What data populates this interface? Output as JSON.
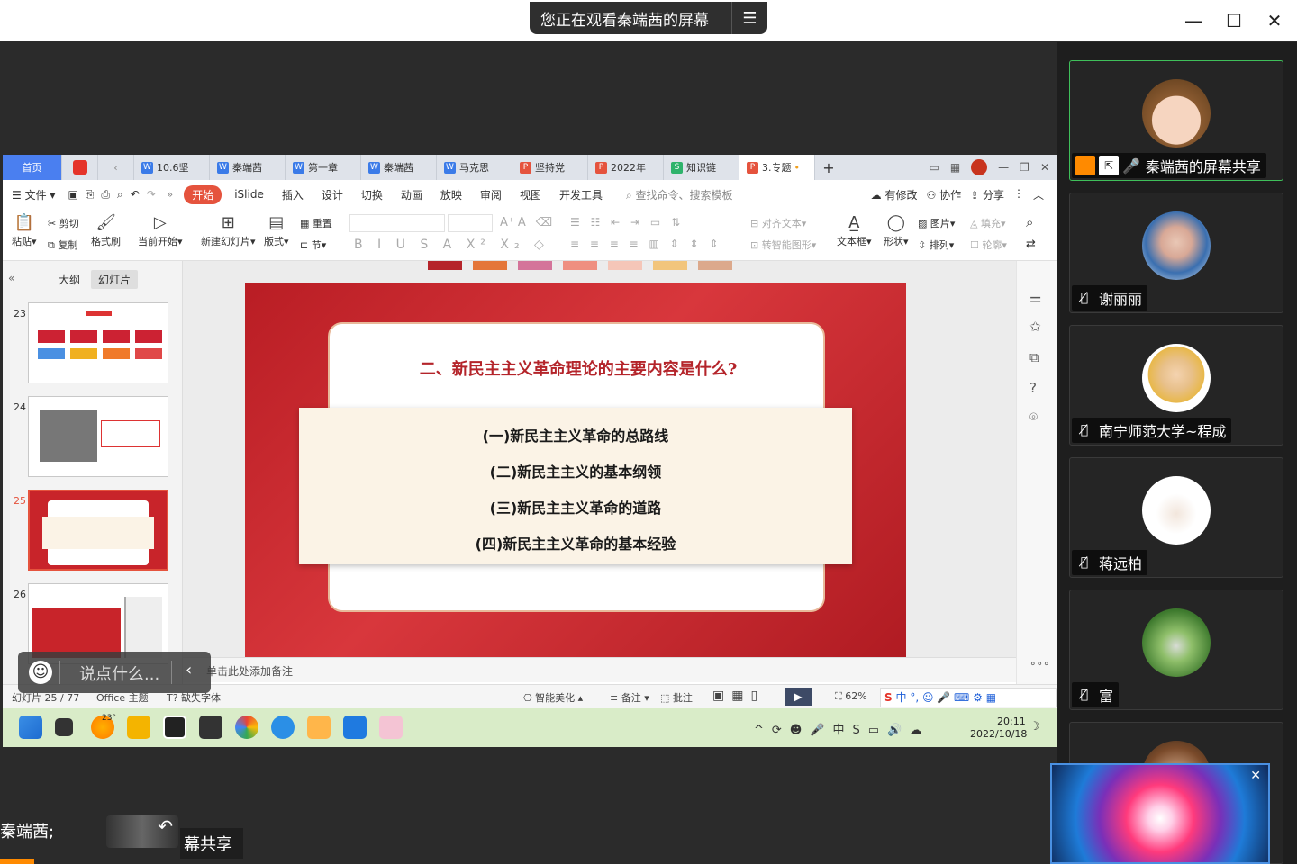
{
  "meeting": {
    "share_banner": "您正在观看秦端茜的屏幕",
    "bottom_name": "秦端茜;",
    "bottom_share_label": "幕共享",
    "chat_placeholder": "说点什么...",
    "participants": [
      {
        "name": "秦端茜的屏幕共享",
        "active": true
      },
      {
        "name": "谢丽丽",
        "active": false
      },
      {
        "name": "南宁师范大学~程成",
        "active": false
      },
      {
        "name": "蒋远柏",
        "active": false
      },
      {
        "name": "富",
        "active": false
      }
    ]
  },
  "wps": {
    "tabs": [
      {
        "label": "首页",
        "kind": "home"
      },
      {
        "label": "10.6坚",
        "color": "#3b7be8",
        "icon": "W"
      },
      {
        "label": "秦端茜",
        "color": "#3b7be8",
        "icon": "W"
      },
      {
        "label": "第一章",
        "color": "#3b7be8",
        "icon": "W"
      },
      {
        "label": "秦端茜",
        "color": "#3b7be8",
        "icon": "W"
      },
      {
        "label": "马克思",
        "color": "#3b7be8",
        "icon": "W"
      },
      {
        "label": "坚持党",
        "color": "#e5533d",
        "icon": "P"
      },
      {
        "label": "2022年",
        "color": "#e5533d",
        "icon": "P"
      },
      {
        "label": "知识链",
        "color": "#2fb36b",
        "icon": "S"
      },
      {
        "label": "3.专题",
        "color": "#e5533d",
        "icon": "P",
        "active": true
      }
    ],
    "menu": [
      "文件",
      "开始",
      "iSlide",
      "插入",
      "设计",
      "切换",
      "动画",
      "放映",
      "审阅",
      "视图",
      "开发工具"
    ],
    "menu_active": "开始",
    "search_placeholder": "查找命令、搜索模板",
    "right_actions": [
      "有修改",
      "协作",
      "分享"
    ],
    "ribbon": {
      "paste": "粘贴",
      "cut": "剪切",
      "copy": "复制",
      "format_painter": "格式刷",
      "from_current": "当前开始",
      "new_slide": "新建幻灯片",
      "layout": "版式",
      "reset": "重置",
      "section": "节",
      "align_text": "对齐文本",
      "smart_shape": "转智能图形",
      "textbox": "文本框",
      "shape": "形状",
      "picture": "图片",
      "fill": "填充",
      "arrange": "排列",
      "outline": "轮廓"
    },
    "left_panel": {
      "tab_outline": "大纲",
      "tab_slides": "幻灯片",
      "slides": [
        {
          "num": "23"
        },
        {
          "num": "24"
        },
        {
          "num": "25",
          "selected": true
        },
        {
          "num": "26"
        }
      ]
    },
    "slide": {
      "title": "二、新民主主义革命理论的主要内容是什么?",
      "items": [
        "(一)新民主主义革命的总路线",
        "(二)新民主主义的基本纲领",
        "(三)新民主主义革命的道路",
        "(四)新民主主义革命的基本经验"
      ]
    },
    "notes_placeholder": "单击此处添加备注",
    "status": {
      "slide_counter": "幻灯片 25 / 77",
      "theme": "Office 主题",
      "missing_font": "缺失字体",
      "beautify": "智能美化",
      "notes": "备注",
      "comments": "批注",
      "zoom": "62%"
    }
  },
  "taskbar": {
    "weather": "23°",
    "time": "20:11",
    "date": "2022/10/18",
    "ime": "中"
  },
  "colors": {
    "accent_red": "#e5533d",
    "wps_blue": "#4a7ff0",
    "active_green": "#3fbf5a"
  }
}
